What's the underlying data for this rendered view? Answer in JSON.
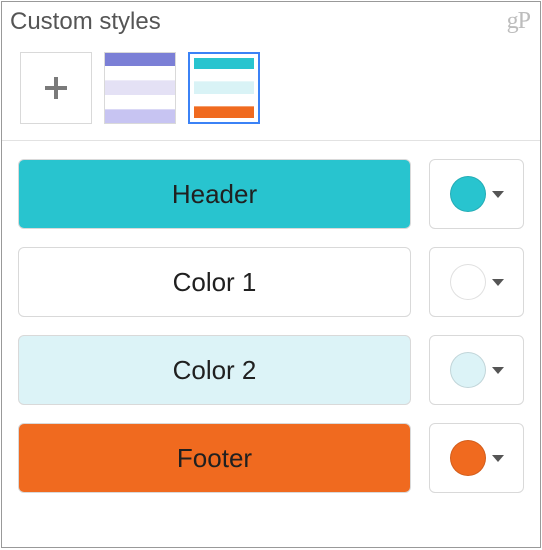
{
  "title": "Custom styles",
  "watermark": "gP",
  "presets": {
    "add_icon": "plus-icon",
    "items": [
      {
        "colors": [
          "#7b7fd6",
          "#ffffff",
          "#e4e1f5",
          "#ffffff",
          "#c7c4f2"
        ],
        "selected": false
      },
      {
        "colors": [
          "#28c4cf",
          "#ffffff",
          "#d9f3f6",
          "#ffffff",
          "#f06a1f"
        ],
        "selected": true
      }
    ]
  },
  "rows": [
    {
      "key": "header",
      "label": "Header",
      "color": "#28c4cf",
      "circle": "#28c4cf"
    },
    {
      "key": "color1",
      "label": "Color 1",
      "color": "#ffffff",
      "circle": "#ffffff"
    },
    {
      "key": "color2",
      "label": "Color 2",
      "color": "#dcf3f7",
      "circle": "#dcf3f7"
    },
    {
      "key": "footer",
      "label": "Footer",
      "color": "#f06a1f",
      "circle": "#f06a1f"
    }
  ]
}
